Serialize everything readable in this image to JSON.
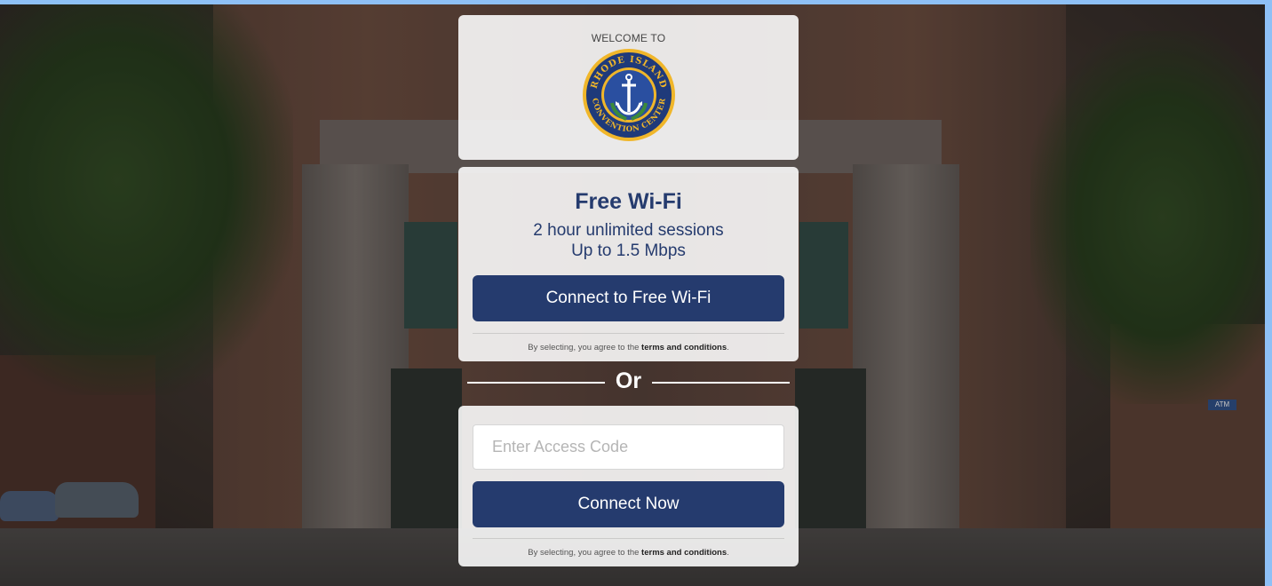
{
  "logo_card": {
    "welcome_text": "WELCOME TO",
    "logo": {
      "icon": "rhode-island-convention-center-seal",
      "ring_text_top": "RHODE ISLAND",
      "ring_text_bottom": "CONVENTION CENTER",
      "colors": {
        "ring": "#f0b62a",
        "inner": "#1f3a7a",
        "anchor": "#ffffff"
      }
    }
  },
  "free_wifi": {
    "title": "Free Wi-Fi",
    "line1": "2 hour unlimited sessions",
    "line2": "Up to 1.5 Mbps",
    "button_label": "Connect to Free Wi-Fi",
    "terms_prefix": "By selecting, you agree to the ",
    "terms_link": "terms and conditions",
    "terms_suffix": "."
  },
  "divider": {
    "text": "Or"
  },
  "access_code": {
    "input_placeholder": "Enter Access Code",
    "input_value": "",
    "button_label": "Connect Now",
    "terms_prefix": "By selecting, you agree to the ",
    "terms_link": "terms and conditions",
    "terms_suffix": "."
  },
  "colors": {
    "primary": "#253b6e",
    "frame": "#8ec0f6",
    "card_bg": "#ffffff"
  },
  "background": {
    "sign_text": "ATM"
  }
}
